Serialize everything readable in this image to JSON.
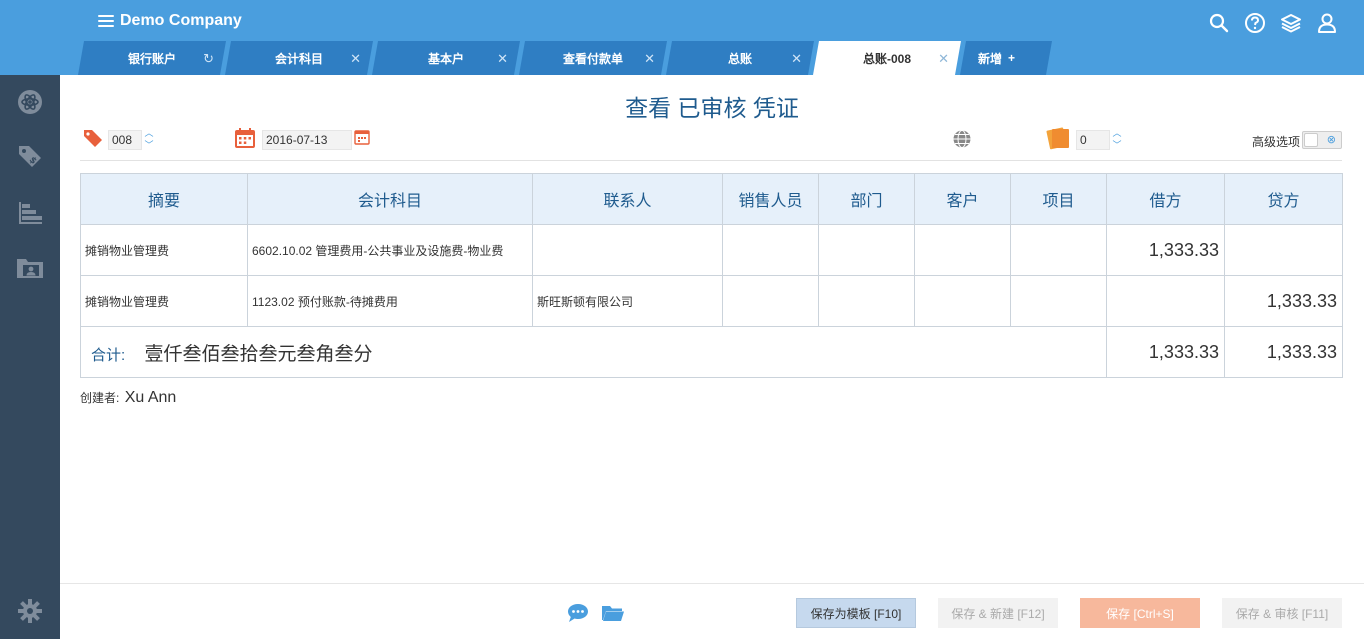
{
  "header": {
    "company": "Demo Company",
    "icons": [
      "search-icon",
      "help-icon",
      "layers-icon",
      "user-icon"
    ]
  },
  "tabs": [
    {
      "label": "银行账户",
      "close": "↻",
      "active": false
    },
    {
      "label": "会计科目",
      "close": "✕",
      "active": false
    },
    {
      "label": "基本户",
      "close": "✕",
      "active": false
    },
    {
      "label": "查看付款单",
      "close": "✕",
      "active": false
    },
    {
      "label": "总账",
      "close": "✕",
      "active": false
    },
    {
      "label": "总账-008",
      "close": "✕",
      "active": true
    },
    {
      "label": "新增",
      "close": "+",
      "active": false
    }
  ],
  "sidebar": {
    "icons": [
      "atom-icon",
      "tags-icon",
      "chart-icon",
      "contacts-folder-icon",
      "settings-icon"
    ]
  },
  "voucher": {
    "title": "查看 已审核 凭证",
    "number": "008",
    "date": "2016-07-13",
    "attachments": "0",
    "advanced_label": "高级选项"
  },
  "table": {
    "headers": [
      "摘要",
      "会计科目",
      "联系人",
      "销售人员",
      "部门",
      "客户",
      "项目",
      "借方",
      "贷方"
    ],
    "rows": [
      {
        "summary": "摊销物业管理费",
        "account": "6602.10.02 管理费用-公共事业及设施费-物业费",
        "contact": "",
        "salesperson": "",
        "department": "",
        "customer": "",
        "project": "",
        "debit": "1,333.33",
        "credit": ""
      },
      {
        "summary": "摊销物业管理费",
        "account": "1123.02 预付账款-待摊费用",
        "contact": "斯旺斯顿有限公司",
        "salesperson": "",
        "department": "",
        "customer": "",
        "project": "",
        "debit": "",
        "credit": "1,333.33"
      }
    ],
    "total_label": "合计:",
    "total_words": "壹仟叁佰叁拾叁元叁角叁分",
    "total_debit": "1,333.33",
    "total_credit": "1,333.33"
  },
  "creator": {
    "label": "创建者:",
    "name": "Xu Ann"
  },
  "footer": {
    "save_template": "保存为模板 [F10]",
    "save_new": "保存 & 新建 [F12]",
    "save": "保存 [Ctrl+S]",
    "save_audit": "保存 & 审核 [F11]"
  },
  "colors": {
    "topbar": "#4a9ede",
    "tab": "#2f7ec3",
    "sidebar": "#34495e",
    "title": "#1f5b8e",
    "header_bg": "#e6f0fa",
    "save_button": "#f7b89c"
  }
}
